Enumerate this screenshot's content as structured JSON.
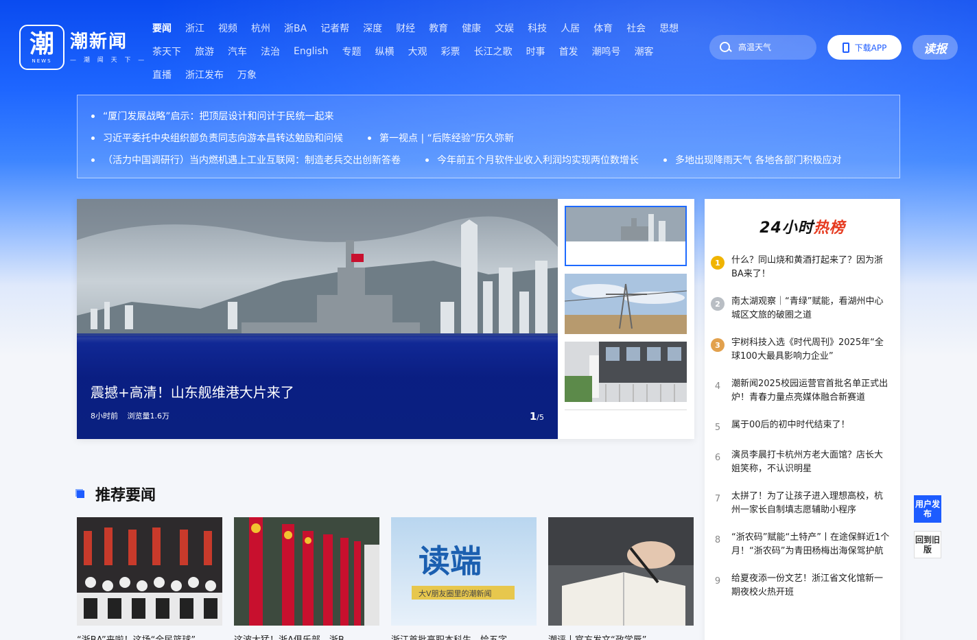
{
  "logo": {
    "glyph": "潮",
    "news": "NEWS",
    "name": "潮新闻",
    "slogan": "— 潮 闻 天 下 —"
  },
  "nav": {
    "rows": [
      [
        "要闻",
        "浙江",
        "视频",
        "杭州",
        "浙BA",
        "记者帮",
        "深度",
        "财经",
        "教育",
        "健康",
        "文娱",
        "科技",
        "人居",
        "体育",
        "社会",
        "思想"
      ],
      [
        "茶天下",
        "旅游",
        "汽车",
        "法治",
        "English",
        "专题",
        "纵横",
        "大观",
        "彩票",
        "长江之歌",
        "时事",
        "首发",
        "潮鸣号",
        "潮客"
      ],
      [
        "直播",
        "浙江发布",
        "万象"
      ]
    ],
    "active": "要闻"
  },
  "search": {
    "placeholder": "高温天气"
  },
  "download": {
    "label": "下载APP"
  },
  "read": {
    "label": "读报"
  },
  "headlines": [
    [
      "“厦门发展战略”启示：把顶层设计和问计于民统一起来"
    ],
    [
      "习近平委托中央组织部负责同志向游本昌转达勉励和问候",
      "第一视点 | “后陈经验”历久弥新"
    ],
    [
      "（活力中国调研行）当内燃机遇上工业互联网：制造老兵交出创新答卷",
      "今年前五个月软件业收入利润均实现两位数增长",
      "多地出现降雨天气 各地各部门积极应对"
    ]
  ],
  "carousel": {
    "title": "震撼+高清！山东舰维港大片来了",
    "time": "8小时前",
    "views": "浏览量1.6万",
    "current": "1",
    "total": "/5"
  },
  "hot": {
    "title_prefix": "24小时",
    "title_word": "热榜",
    "items": [
      {
        "rank": "1",
        "text": "什么？同山烧和黄酒打起来了？因为浙BA来了！"
      },
      {
        "rank": "2",
        "text": "南太湖观察｜“青绿”赋能，看湖州中心城区文旅的破圈之道"
      },
      {
        "rank": "3",
        "text": "宇树科技入选《时代周刊》2025年“全球100大最具影响力企业”"
      },
      {
        "rank": "4",
        "text": "潮新闻2025校园运营官首批名单正式出炉！青春力量点亮媒体融合新赛道"
      },
      {
        "rank": "5",
        "text": "属于00后的初中时代结束了！"
      },
      {
        "rank": "6",
        "text": "演员李晨打卡杭州方老大面馆？店长大姐笑称，不认识明星"
      },
      {
        "rank": "7",
        "text": "太拼了！为了让孩子进入理想高校，杭州一家长自制填志愿辅助小程序"
      },
      {
        "rank": "8",
        "text": "“浙农码”赋能“土特产”丨在途保鲜近1个月！“浙农码”为青田杨梅出海保驾护航"
      },
      {
        "rank": "9",
        "text": "给夏夜添一份文艺！浙江省文化馆新一期夜校火热开班"
      }
    ]
  },
  "section": {
    "title": "推荐要闻"
  },
  "cards": [
    {
      "text": "“浙BA”来啦！这场“全民篮球”"
    },
    {
      "text": "这波太猛！浙A俱乐部，浙B"
    },
    {
      "text": "浙江首批高职本科生，恰五字"
    },
    {
      "text": "潮评丨官方发文“政学唇”"
    }
  ],
  "side": {
    "publish": "用户发布",
    "old": "回到旧版"
  },
  "colors": {
    "brand": "#1d5cff",
    "hot": "#e63a1f"
  }
}
